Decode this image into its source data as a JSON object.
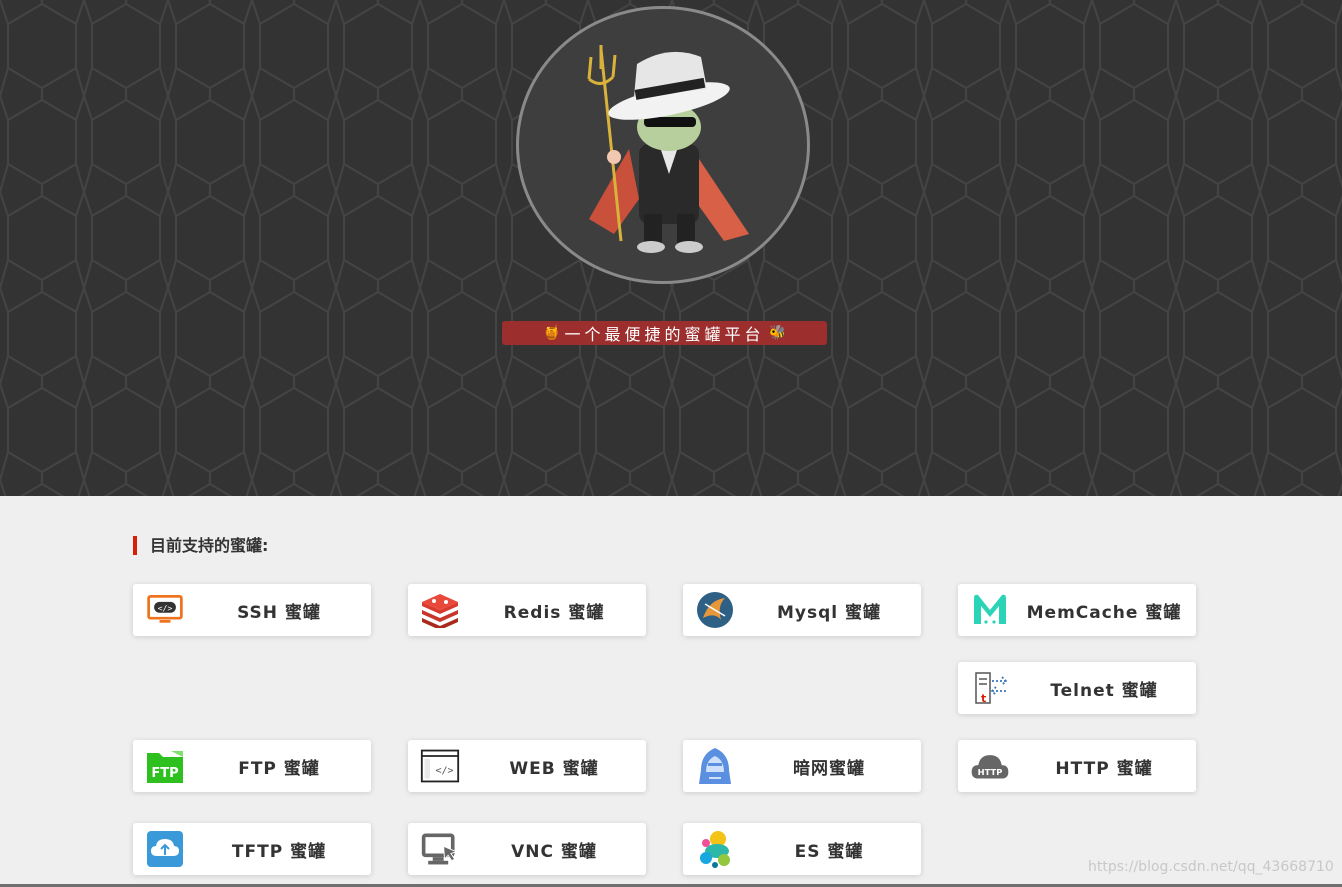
{
  "hero": {
    "tagline_prefix_icon": "honey-pot-icon",
    "tagline": "一个最便捷的蜜罐平台",
    "tagline_suffix_icon": "bee-icon",
    "avatar_icon": "devil-mascot-avatar",
    "background_color": "#333333",
    "tagline_color": "#9c2e2e"
  },
  "section": {
    "title": "目前支持的蜜罐:",
    "accent_color": "#d81e06"
  },
  "honeypots": [
    {
      "label": "SSH 蜜罐",
      "icon": "terminal-monitor-icon"
    },
    {
      "label": "Redis 蜜罐",
      "icon": "redis-icon"
    },
    {
      "label": "Mysql 蜜罐",
      "icon": "mysql-icon"
    },
    {
      "label": "MemCache 蜜罐",
      "icon": "memcache-icon"
    },
    {
      "label": "Telnet 蜜罐",
      "icon": "telnet-icon"
    },
    {
      "label": "FTP 蜜罐",
      "icon": "ftp-folder-icon"
    },
    {
      "label": "WEB 蜜罐",
      "icon": "web-code-icon"
    },
    {
      "label": "暗网蜜罐",
      "icon": "hooded-hacker-icon"
    },
    {
      "label": "HTTP 蜜罐",
      "icon": "http-cloud-icon"
    },
    {
      "label": "TFTP 蜜罐",
      "icon": "tftp-upload-icon"
    },
    {
      "label": "VNC 蜜罐",
      "icon": "vnc-remote-icon"
    },
    {
      "label": "ES 蜜罐",
      "icon": "elasticsearch-icon"
    }
  ],
  "watermark": "https://blog.csdn.net/qq_43668710"
}
